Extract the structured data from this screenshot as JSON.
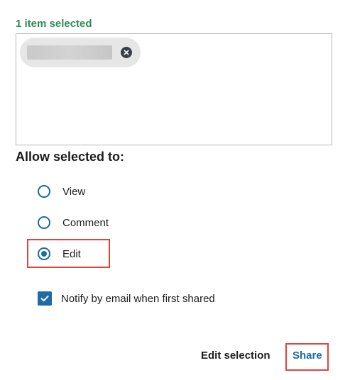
{
  "selection": {
    "count_label": "1 item selected",
    "chip_remove_icon": "close-icon"
  },
  "permissions": {
    "heading": "Allow selected to:",
    "options": [
      {
        "label": "View",
        "selected": false
      },
      {
        "label": "Comment",
        "selected": false
      },
      {
        "label": "Edit",
        "selected": true
      }
    ]
  },
  "notify": {
    "label": "Notify by email when first shared",
    "checked": true
  },
  "footer": {
    "edit_selection_label": "Edit selection",
    "share_label": "Share"
  },
  "colors": {
    "accent": "#1d6aa5",
    "count_green": "#2e8b57",
    "highlight_red": "#e0453c"
  }
}
